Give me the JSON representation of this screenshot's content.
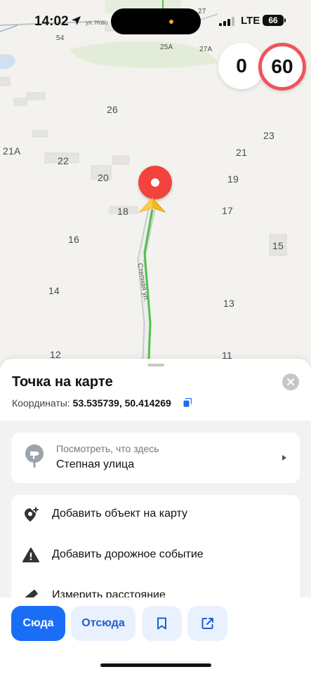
{
  "status_bar": {
    "time": "14:02",
    "network": "LTE",
    "battery": "66"
  },
  "map": {
    "street_top_label": "ул. Ново",
    "street_label": "Степная ул.",
    "house_numbers": {
      "n27": "27",
      "n54": "54",
      "n25a": "25А",
      "n27a": "27А",
      "n26": "26",
      "n23": "23",
      "n21a": "21А",
      "n22": "22",
      "n21": "21",
      "n20": "20",
      "n19": "19",
      "n18": "18",
      "n17": "17",
      "n16": "16",
      "n15": "15",
      "n14": "14",
      "n13": "13",
      "n12": "12",
      "n11": "11"
    },
    "current_speed": "0",
    "speed_limit": "60",
    "pin_color": "#f2433c",
    "route_color": "#4fc24a"
  },
  "sheet": {
    "title": "Точка на карте",
    "coords_label": "Координаты:",
    "coords_value": "53.535739, 50.414269",
    "whats_here": {
      "subtitle": "Посмотреть, что здесь",
      "title": "Степная улица"
    },
    "actions": [
      {
        "label": "Добавить объект на карту",
        "icon": "add-place-icon"
      },
      {
        "label": "Добавить дорожное событие",
        "icon": "warning-icon"
      },
      {
        "label": "Измерить расстояние",
        "icon": "ruler-icon"
      }
    ]
  },
  "bottom_bar": {
    "here_label": "Сюда",
    "from_label": "Отсюда",
    "accent": "#1a6ef5"
  }
}
